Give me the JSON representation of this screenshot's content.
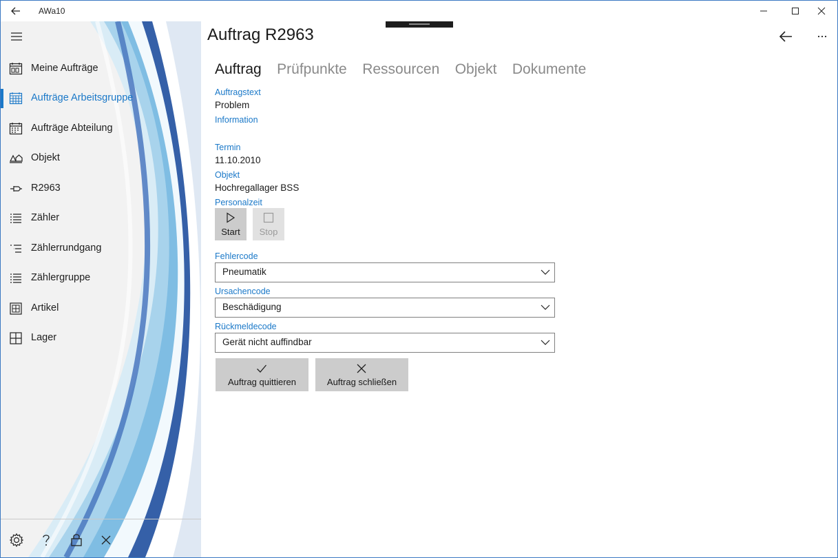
{
  "window": {
    "title": "AWa10"
  },
  "sidebar": {
    "items": [
      {
        "label": "Meine Aufträge",
        "icon": "calendar-week-icon"
      },
      {
        "label": "Aufträge Arbeitsgruppe",
        "icon": "calendar-month-icon",
        "active": true
      },
      {
        "label": "Aufträge Abteilung",
        "icon": "calendar-icon"
      },
      {
        "label": "Objekt",
        "icon": "objects-icon"
      },
      {
        "label": "R2963",
        "icon": "pin-icon"
      },
      {
        "label": "Zähler",
        "icon": "list-icon"
      },
      {
        "label": "Zählerrundgang",
        "icon": "bulleted-list-icon"
      },
      {
        "label": "Zählergruppe",
        "icon": "list-icon"
      },
      {
        "label": "Artikel",
        "icon": "grid-box-icon"
      },
      {
        "label": "Lager",
        "icon": "grid-icon"
      }
    ],
    "footer": [
      "gear-icon",
      "help-icon",
      "lock-icon",
      "close-icon"
    ]
  },
  "page": {
    "title": "Auftrag R2963"
  },
  "tabs": [
    "Auftrag",
    "Prüfpunkte",
    "Ressourcen",
    "Objekt",
    "Dokumente"
  ],
  "form": {
    "auftragstext_label": "Auftragstext",
    "auftragstext_value": "Problem",
    "information_label": "Information",
    "termin_label": "Termin",
    "termin_value": "11.10.2010",
    "objekt_label": "Objekt",
    "objekt_value": "Hochregallager BSS",
    "personalzeit_label": "Personalzeit",
    "start_label": "Start",
    "stop_label": "Stop",
    "fehlercode_label": "Fehlercode",
    "fehlercode_value": "Pneumatik",
    "ursachencode_label": "Ursachencode",
    "ursachencode_value": "Beschädigung",
    "rueckmeldecode_label": "Rückmeldecode",
    "rueckmeldecode_value": "Gerät nicht auffindbar",
    "quittieren_label": "Auftrag quittieren",
    "schliessen_label": "Auftrag schließen"
  },
  "colors": {
    "accent": "#1a78c8",
    "button_gray": "#cccccc",
    "sidebar_bg": "#f2f2f2"
  }
}
